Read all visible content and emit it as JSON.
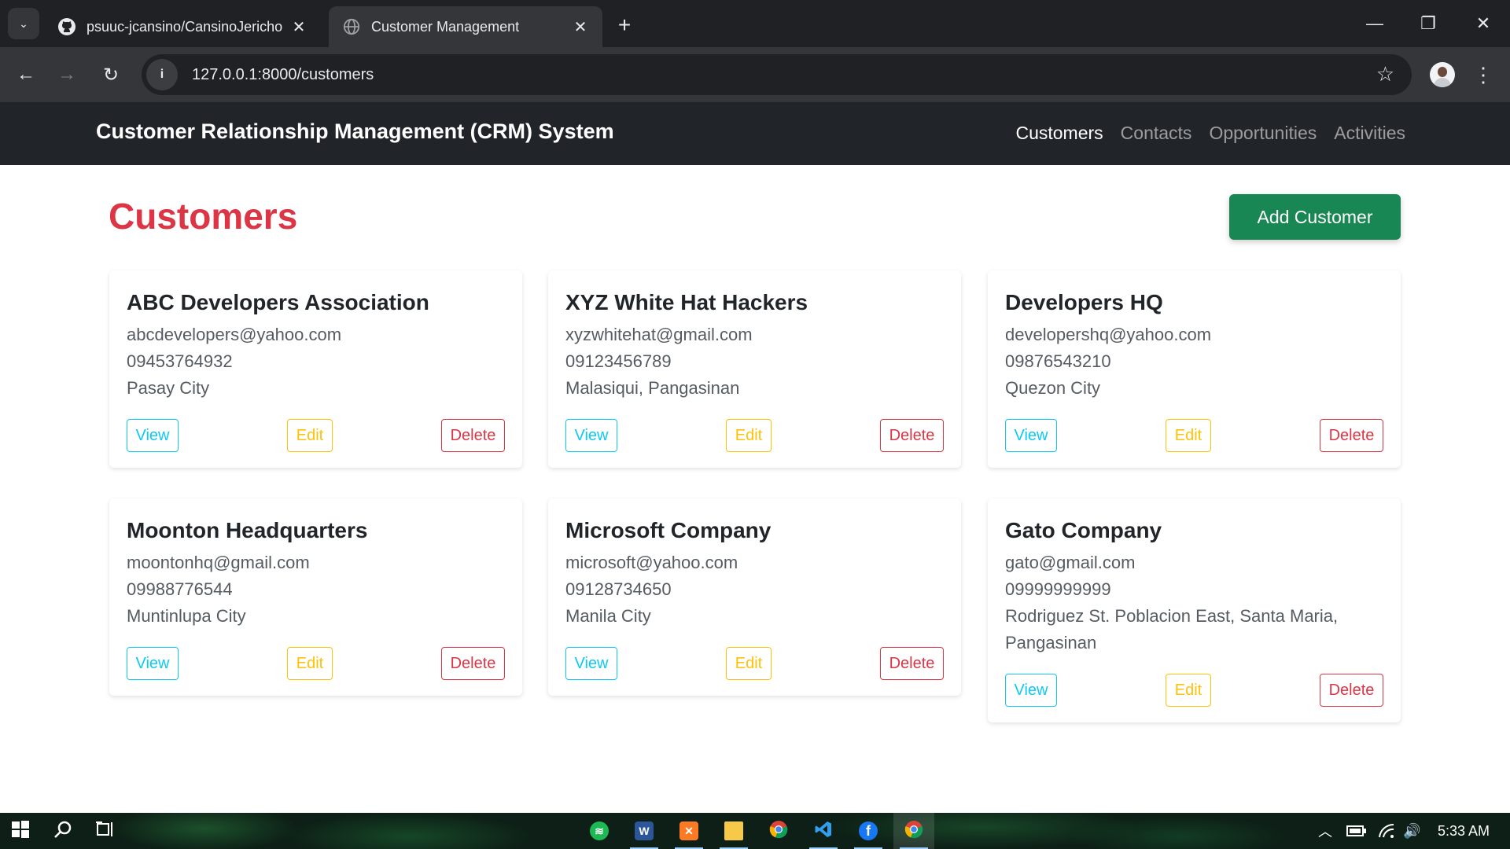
{
  "browser": {
    "tabs": [
      {
        "title": "psuuc-jcansino/CansinoJericho",
        "icon": "github-icon",
        "active": false
      },
      {
        "title": "Customer Management",
        "icon": "globe-icon",
        "active": true
      }
    ],
    "url": "127.0.0.1:8000/customers"
  },
  "navbar": {
    "brand": "Customer Relationship Management (CRM) System",
    "links": [
      "Customers",
      "Contacts",
      "Opportunities",
      "Activities"
    ],
    "active_link": "Customers"
  },
  "page": {
    "title": "Customers",
    "add_button": "Add Customer"
  },
  "card_actions": {
    "view": "View",
    "edit": "Edit",
    "delete": "Delete"
  },
  "customers": [
    {
      "name": "ABC Developers Association",
      "email": "abcdevelopers@yahoo.com",
      "phone": "09453764932",
      "address_lines": [
        "Pasay City"
      ]
    },
    {
      "name": "XYZ White Hat Hackers",
      "email": "xyzwhitehat@gmail.com",
      "phone": "09123456789",
      "address_lines": [
        "Malasiqui, Pangasinan"
      ]
    },
    {
      "name": "Developers HQ",
      "email": "developershq@yahoo.com",
      "phone": "09876543210",
      "address_lines": [
        "Quezon City"
      ]
    },
    {
      "name": "Moonton Headquarters",
      "email": "moontonhq@gmail.com",
      "phone": "09988776544",
      "address_lines": [
        "Muntinlupa City"
      ]
    },
    {
      "name": "Microsoft Company",
      "email": "microsoft@yahoo.com",
      "phone": "09128734650",
      "address_lines": [
        "Manila City"
      ]
    },
    {
      "name": "Gato Company",
      "email": "gato@gmail.com",
      "phone": "09999999999",
      "address_lines": [
        "Rodriguez St. Poblacion East, Santa Maria,",
        "Pangasinan"
      ]
    }
  ],
  "taskbar": {
    "apps": [
      "spotify-icon",
      "word-icon",
      "xampp-icon",
      "file-explorer-icon",
      "chrome-icon",
      "vscode-icon",
      "facebook-icon",
      "chrome-active-icon"
    ],
    "time": "5:33 AM"
  },
  "colors": {
    "brand_red": "#dc3545",
    "success_green": "#198754",
    "info_cyan": "#0dcaf0",
    "warning_yellow": "#ffc107",
    "navbar_dark": "#212529"
  }
}
